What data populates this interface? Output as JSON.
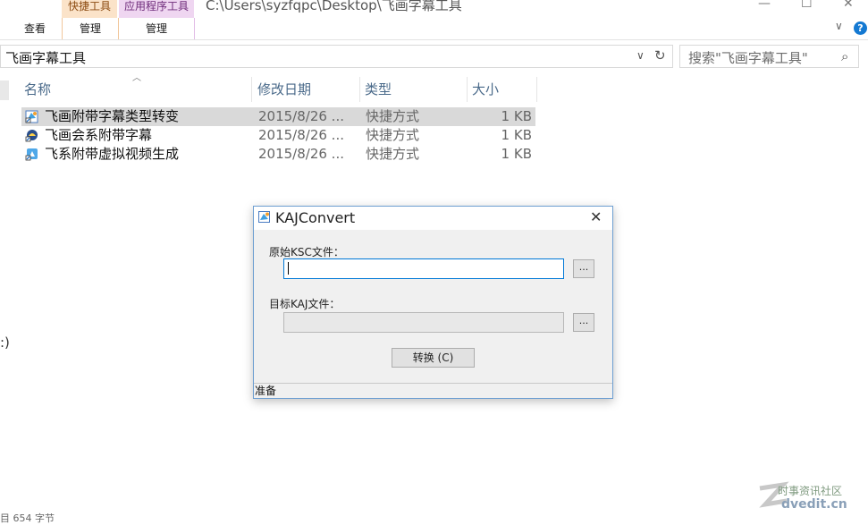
{
  "ribbon": {
    "context_tabs": [
      {
        "label": "快捷工具",
        "sub": "管理"
      },
      {
        "label": "应用程序工具",
        "sub": "管理"
      }
    ],
    "view_tab": "查看",
    "title_path": "C:\\Users\\syzfqpc\\Desktop\\飞画字幕工具",
    "help": "?"
  },
  "address": {
    "path": "飞画字幕工具",
    "search_placeholder": "搜索\"飞画字幕工具\""
  },
  "columns": {
    "name": "名称",
    "date": "修改日期",
    "type": "类型",
    "size": "大小"
  },
  "files": [
    {
      "name": "飞画附带字幕类型转变",
      "date": "2015/8/26 ...",
      "type": "快捷方式",
      "size": "1 KB",
      "selected": true
    },
    {
      "name": "飞画会系附带字幕",
      "date": "2015/8/26 ...",
      "type": "快捷方式",
      "size": "1 KB",
      "selected": false
    },
    {
      "name": "飞系附带虚拟视频生成",
      "date": "2015/8/26 ...",
      "type": "快捷方式",
      "size": "1 KB",
      "selected": false
    }
  ],
  "left_fragment": ":)",
  "status_bar": "目 654 字节",
  "watermark": {
    "line1": "时事资讯社区",
    "line2": "dvedit.cn"
  },
  "dialog": {
    "title": "KAJConvert",
    "source_label": "原始KSC文件：",
    "source_value": "",
    "target_label": "目标KAJ文件：",
    "target_value": "",
    "browse_label": "...",
    "convert_label": "转换 (C)",
    "status": "准备"
  },
  "colors": {
    "accent": "#0078d7",
    "selection": "#d9d9d9",
    "shortcut_tab": "#fbe3c9",
    "app_tab": "#efd6f1"
  }
}
